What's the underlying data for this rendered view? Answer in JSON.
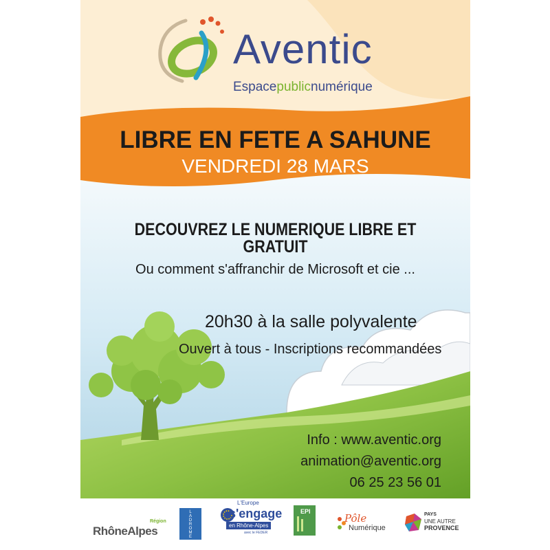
{
  "logo": {
    "brand": "Aventic",
    "tagline_part1": "Espace",
    "tagline_part2": "public",
    "tagline_part3": "numérique"
  },
  "event": {
    "title": "LIBRE EN FETE A SAHUNE",
    "date": "VENDREDI 28 MARS",
    "headline": "DECOUVREZ LE NUMERIQUE LIBRE ET GRATUIT",
    "subline": "Ou comment s'affranchir de Microsoft et cie ...",
    "time_place": "20h30 à la salle polyvalente",
    "open_note": "Ouvert à tous - Inscriptions recommandées"
  },
  "contact": {
    "url": "Info : www.aventic.org",
    "email": "animation@aventic.org",
    "phone": "06 25 23 56 01"
  },
  "partners": {
    "rhone_alpes_region": "Région",
    "rhone_alpes": "RhôneAlpes",
    "drome": [
      "L",
      "A",
      "D",
      "R",
      "O",
      "M",
      "E"
    ],
    "europe_line1": "L'Europe",
    "europe_line2": "s'engage",
    "europe_line3": "en Rhône-Alpes",
    "europe_line4": "avec le FEDER",
    "epi": "EPI",
    "pole_line1": "Pôle",
    "pole_line2": "Numérique",
    "pays_line1": "PAYS",
    "pays_line2": "UNE AUTRE",
    "pays_line3": "PROVENCE"
  },
  "colors": {
    "orange": "#f08a24",
    "cream": "#fdeed4",
    "sky": "#cfe6f2",
    "grass_dark": "#5f9e25",
    "grass_light": "#a8d05a",
    "tree": "#8fc446",
    "navy": "#3b4a8c"
  }
}
